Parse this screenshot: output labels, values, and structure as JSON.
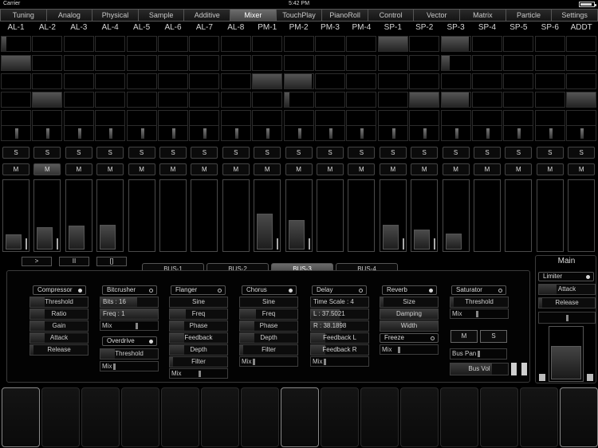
{
  "status": {
    "carrier": "Carrier",
    "time": "5:42 PM",
    "battery_pct": 90
  },
  "tabs": [
    {
      "label": "Tuning",
      "active": false
    },
    {
      "label": "Analog",
      "active": false
    },
    {
      "label": "Physical",
      "active": false
    },
    {
      "label": "Sample",
      "active": false
    },
    {
      "label": "Additive",
      "active": false
    },
    {
      "label": "Mixer",
      "active": true
    },
    {
      "label": "TouchPlay",
      "active": false
    },
    {
      "label": "PianoRoll",
      "active": false
    },
    {
      "label": "Control",
      "active": false
    },
    {
      "label": "Vector",
      "active": false
    },
    {
      "label": "Matrix",
      "active": false
    },
    {
      "label": "Particle",
      "active": false
    },
    {
      "label": "Settings",
      "active": false
    }
  ],
  "channels": [
    {
      "name": "AL-1",
      "solo": "S",
      "mute": "M",
      "mute_on": false,
      "level": 0.22,
      "meter": true
    },
    {
      "name": "AL-2",
      "solo": "S",
      "mute": "M",
      "mute_on": true,
      "level": 0.33,
      "meter": true
    },
    {
      "name": "AL-3",
      "solo": "S",
      "mute": "M",
      "mute_on": false,
      "level": 0.35,
      "meter": false
    },
    {
      "name": "AL-4",
      "solo": "S",
      "mute": "M",
      "mute_on": false,
      "level": 0.37,
      "meter": false
    },
    {
      "name": "AL-5",
      "solo": "S",
      "mute": "M",
      "mute_on": false,
      "level": 0.0,
      "meter": false
    },
    {
      "name": "AL-6",
      "solo": "S",
      "mute": "M",
      "mute_on": false,
      "level": 0.0,
      "meter": false
    },
    {
      "name": "AL-7",
      "solo": "S",
      "mute": "M",
      "mute_on": false,
      "level": 0.0,
      "meter": false
    },
    {
      "name": "AL-8",
      "solo": "S",
      "mute": "M",
      "mute_on": false,
      "level": 0.0,
      "meter": false
    },
    {
      "name": "PM-1",
      "solo": "S",
      "mute": "M",
      "mute_on": false,
      "level": 0.53,
      "meter": true
    },
    {
      "name": "PM-2",
      "solo": "S",
      "mute": "M",
      "mute_on": false,
      "level": 0.43,
      "meter": true
    },
    {
      "name": "PM-3",
      "solo": "S",
      "mute": "M",
      "mute_on": false,
      "level": 0.0,
      "meter": false
    },
    {
      "name": "PM-4",
      "solo": "S",
      "mute": "M",
      "mute_on": false,
      "level": 0.0,
      "meter": false
    },
    {
      "name": "SP-1",
      "solo": "S",
      "mute": "M",
      "mute_on": false,
      "level": 0.37,
      "meter": true
    },
    {
      "name": "SP-2",
      "solo": "S",
      "mute": "M",
      "mute_on": false,
      "level": 0.3,
      "meter": true
    },
    {
      "name": "SP-3",
      "solo": "S",
      "mute": "M",
      "mute_on": false,
      "level": 0.23,
      "meter": false
    },
    {
      "name": "SP-4",
      "solo": "S",
      "mute": "M",
      "mute_on": false,
      "level": 0.0,
      "meter": false
    },
    {
      "name": "SP-5",
      "solo": "S",
      "mute": "M",
      "mute_on": false,
      "level": 0.0,
      "meter": false
    },
    {
      "name": "SP-6",
      "solo": "S",
      "mute": "M",
      "mute_on": false,
      "level": 0.0,
      "meter": false
    },
    {
      "name": "ADDT",
      "solo": "S",
      "mute": "M",
      "mute_on": false,
      "level": 0.0,
      "meter": false
    }
  ],
  "transport": {
    "play": ">",
    "pause": "II",
    "stop": "[]"
  },
  "buses": [
    {
      "label": "BUS-1",
      "active": false
    },
    {
      "label": "BUS-2",
      "active": false
    },
    {
      "label": "BUS-3",
      "active": true
    },
    {
      "label": "BUS-4",
      "active": false
    }
  ],
  "fx": {
    "compressor": {
      "name": "Compressor",
      "on": true,
      "params": [
        "Threshold",
        "Ratio",
        "Gain",
        "Attack",
        "Release"
      ]
    },
    "bitcrusher": {
      "name": "Bitcrusher",
      "on": false,
      "bits": "Bits : 16",
      "freq": "Freq : 1",
      "mix": "Mix"
    },
    "overdrive": {
      "name": "Overdrive",
      "on": true,
      "threshold": "Threshold",
      "mix": "Mix"
    },
    "flanger": {
      "name": "Flanger",
      "on": false,
      "params": [
        "Sine",
        "Freq",
        "Phase",
        "Feedback",
        "Depth",
        "Filter"
      ],
      "mix": "Mix"
    },
    "chorus": {
      "name": "Chorus",
      "on": true,
      "params": [
        "Sine",
        "Freq",
        "Phase",
        "Depth",
        "Filter"
      ],
      "mix": "Mix"
    },
    "delay": {
      "name": "Delay",
      "on": false,
      "params": [
        "Time Scale : 4",
        "L : 37.5021",
        "R : 38.1898",
        "Feedback L",
        "Feedback R"
      ],
      "mix": "Mix"
    },
    "reverb": {
      "name": "Reverb",
      "on": true,
      "params": [
        "Size",
        "Damping",
        "Width"
      ],
      "freeze": "Freeze",
      "mix": "Mix"
    },
    "saturator": {
      "name": "Saturator",
      "on": false,
      "threshold": "Threshold",
      "mix": "Mix"
    },
    "bus_controls": {
      "mute": "M",
      "solo": "S",
      "pan": "Bus Pan",
      "vol": "Bus Vol"
    }
  },
  "main": {
    "title": "Main",
    "limiter": "Limiter",
    "limiter_on": true,
    "attack": "Attack",
    "release": "Release"
  }
}
